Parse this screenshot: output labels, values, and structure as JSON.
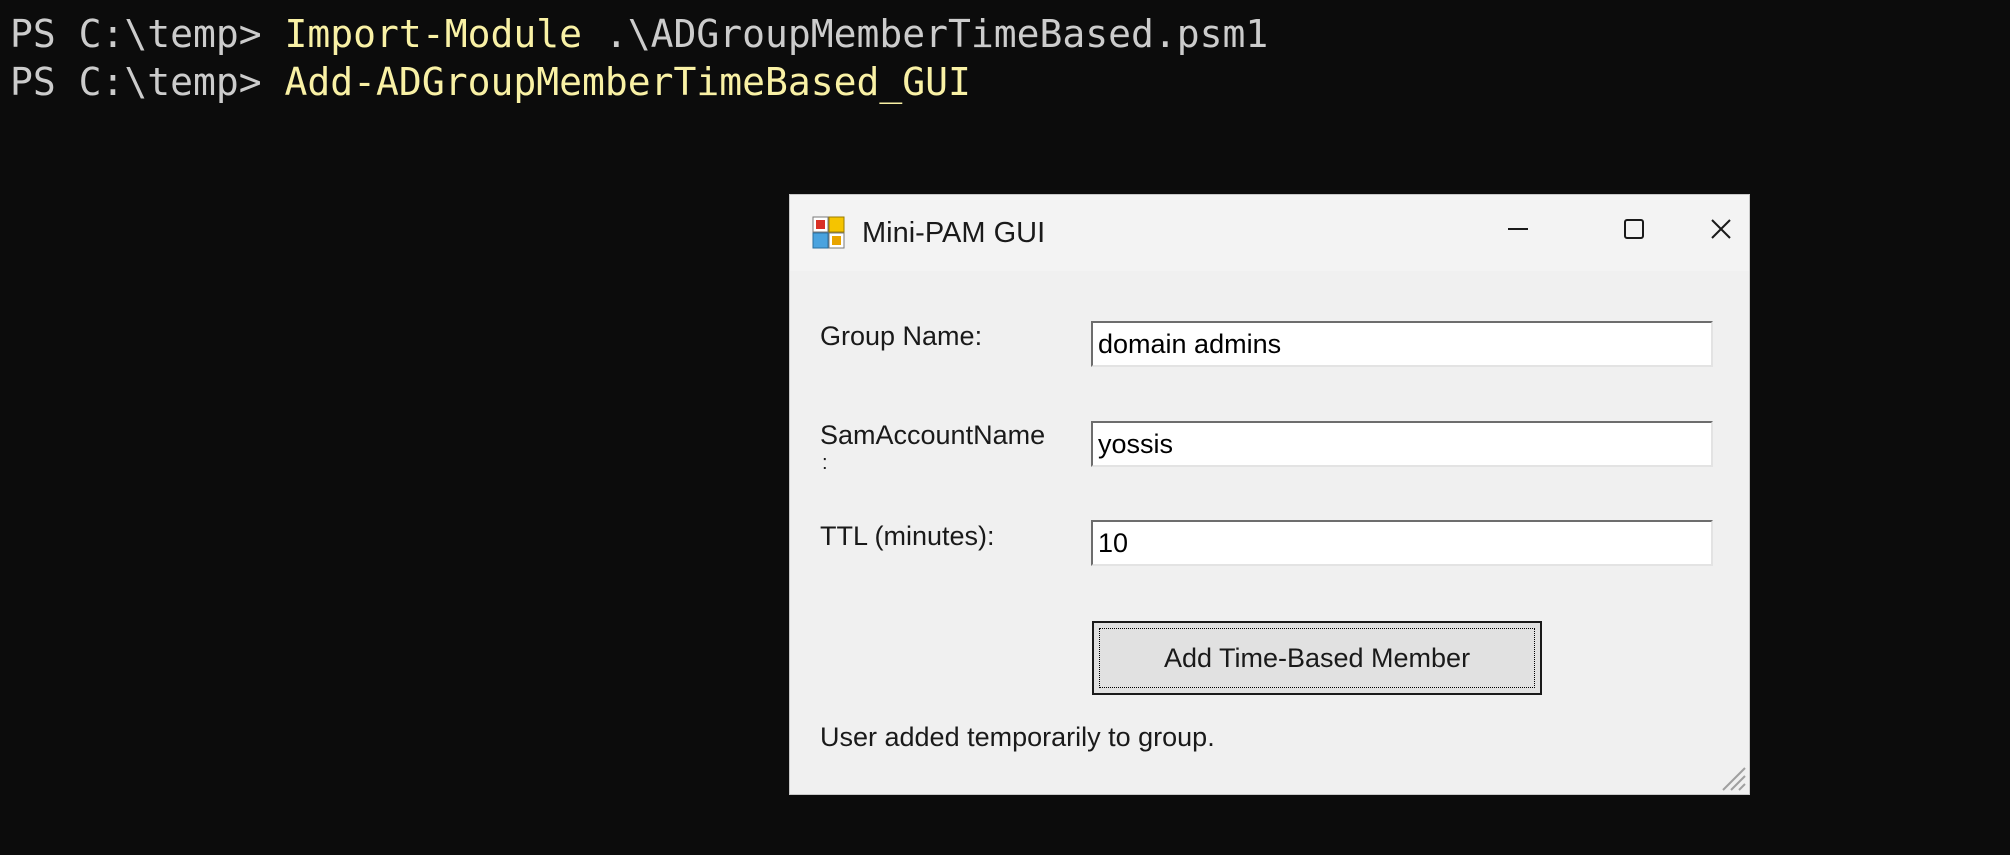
{
  "terminal": {
    "line1": {
      "prompt": "PS C:\\temp> ",
      "command": "Import-Module",
      "argument": " .\\ADGroupMemberTimeBased.psm1"
    },
    "line2": {
      "prompt": "PS C:\\temp> ",
      "command": "Add-ADGroupMemberTimeBased_GUI"
    }
  },
  "window": {
    "title": "Mini-PAM GUI",
    "icons": {
      "app": "app-icon",
      "minimize": "minimize-icon",
      "maximize": "maximize-icon",
      "close": "close-icon"
    },
    "form": {
      "group_label": "Group Name:",
      "group_value": "domain admins",
      "sam_label": "SamAccountName",
      "sam_label_tail": ":",
      "sam_value": "yossis",
      "ttl_label": "TTL (minutes):",
      "ttl_value": "10"
    },
    "add_button_label": "Add Time-Based Member",
    "status": "User added temporarily to group."
  },
  "colors": {
    "terminal_bg": "#0c0c0c",
    "terminal_text": "#cccccc",
    "command_highlight": "#f9f1a5",
    "window_bg": "#f0f0f0"
  }
}
